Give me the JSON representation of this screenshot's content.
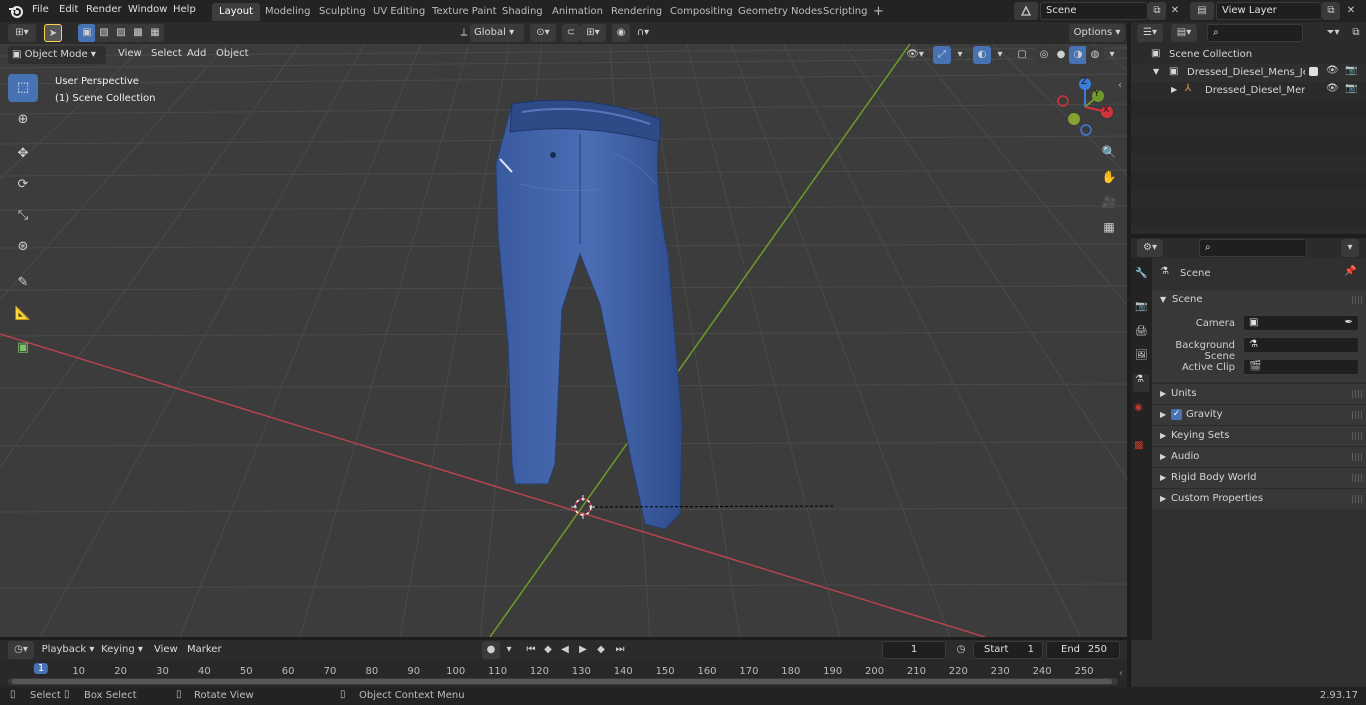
{
  "top_menu": {
    "items": [
      "File",
      "Edit",
      "Render",
      "Window",
      "Help"
    ]
  },
  "workspaces": [
    {
      "label": "Layout",
      "active": true
    },
    {
      "label": "Modeling",
      "active": false
    },
    {
      "label": "Sculpting",
      "active": false
    },
    {
      "label": "UV Editing",
      "active": false
    },
    {
      "label": "Texture Paint",
      "active": false
    },
    {
      "label": "Shading",
      "active": false
    },
    {
      "label": "Animation",
      "active": false
    },
    {
      "label": "Rendering",
      "active": false
    },
    {
      "label": "Compositing",
      "active": false
    },
    {
      "label": "Geometry Nodes",
      "active": false
    },
    {
      "label": "Scripting",
      "active": false
    }
  ],
  "add_workspace": "+",
  "scene_field": {
    "value": "Scene"
  },
  "view_layer_field": {
    "value": "View Layer"
  },
  "viewport_header": {
    "mode": "Object Mode",
    "menus": [
      "View",
      "Select",
      "Add",
      "Object"
    ],
    "transform_orientation": "Global",
    "options": "Options"
  },
  "viewport_overlay": {
    "perspective": "User Perspective",
    "collection": "(1) Scene Collection"
  },
  "gizmo": {
    "z": "Z",
    "y": "Y",
    "x": "X"
  },
  "outliner": {
    "root": "Scene Collection",
    "items": [
      {
        "label": "Dressed_Diesel_Mens_Jeans_I"
      },
      {
        "label": "Dressed_Diesel_Mens_Jea"
      }
    ]
  },
  "properties": {
    "context": "Scene",
    "section": "Scene",
    "fields": [
      {
        "label": "Camera"
      },
      {
        "label": "Background Scene"
      },
      {
        "label": "Active Clip"
      }
    ],
    "panels": [
      "Units",
      "Gravity",
      "Keying Sets",
      "Audio",
      "Rigid Body World",
      "Custom Properties"
    ],
    "gravity_checked": true
  },
  "timeline": {
    "menus": [
      "Playback",
      "Keying",
      "View",
      "Marker"
    ],
    "current_frame": "1",
    "start_label": "Start",
    "start": "1",
    "end_label": "End",
    "end": "250",
    "ticks": [
      "1",
      "10",
      "20",
      "30",
      "40",
      "50",
      "60",
      "70",
      "80",
      "90",
      "100",
      "110",
      "120",
      "130",
      "140",
      "150",
      "160",
      "170",
      "180",
      "190",
      "200",
      "210",
      "220",
      "230",
      "240",
      "250"
    ]
  },
  "status_bar": {
    "select": "Select",
    "box_select": "Box Select",
    "rotate_view": "Rotate View",
    "context_menu": "Object Context Menu",
    "version": "2.93.17"
  },
  "colors": {
    "accent": "#4772b3",
    "x_axis": "#c23f4a",
    "y_axis": "#6f9a2a",
    "denim": "#3c5fa6"
  }
}
